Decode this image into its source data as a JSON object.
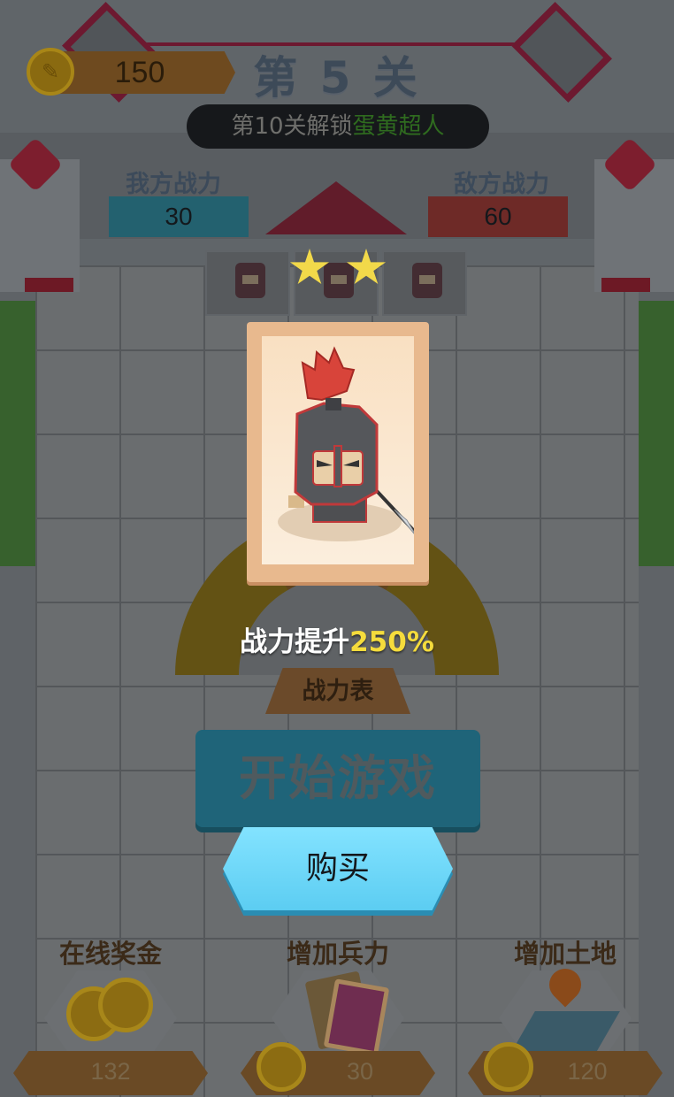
{
  "hud": {
    "coins": "150",
    "level_title": "第 5 关",
    "unlock_prefix": "第10关解锁",
    "unlock_reward": "蛋黄超人"
  },
  "battle": {
    "my_power_label": "我方战力",
    "my_power_value": "30",
    "enemy_power_label": "敌方战力",
    "enemy_power_value": "60",
    "stars_shown": 2
  },
  "reward_card": {
    "boost_prefix": "战力提升",
    "boost_percent": "250%"
  },
  "gauge": {
    "label": "战力表"
  },
  "buttons": {
    "start_game": "开始游戏",
    "buy": "购买"
  },
  "shop": {
    "items": [
      {
        "title": "在线奖金",
        "price": "132",
        "icon": "coins-icon"
      },
      {
        "title": "增加兵力",
        "price": "30",
        "icon": "cards-icon"
      },
      {
        "title": "增加土地",
        "price": "120",
        "icon": "land-icon"
      }
    ]
  },
  "colors": {
    "buy_button": "#6fd8f7",
    "boost_percent": "#f5dc3c",
    "unlock_reward": "#2f6b1f"
  }
}
